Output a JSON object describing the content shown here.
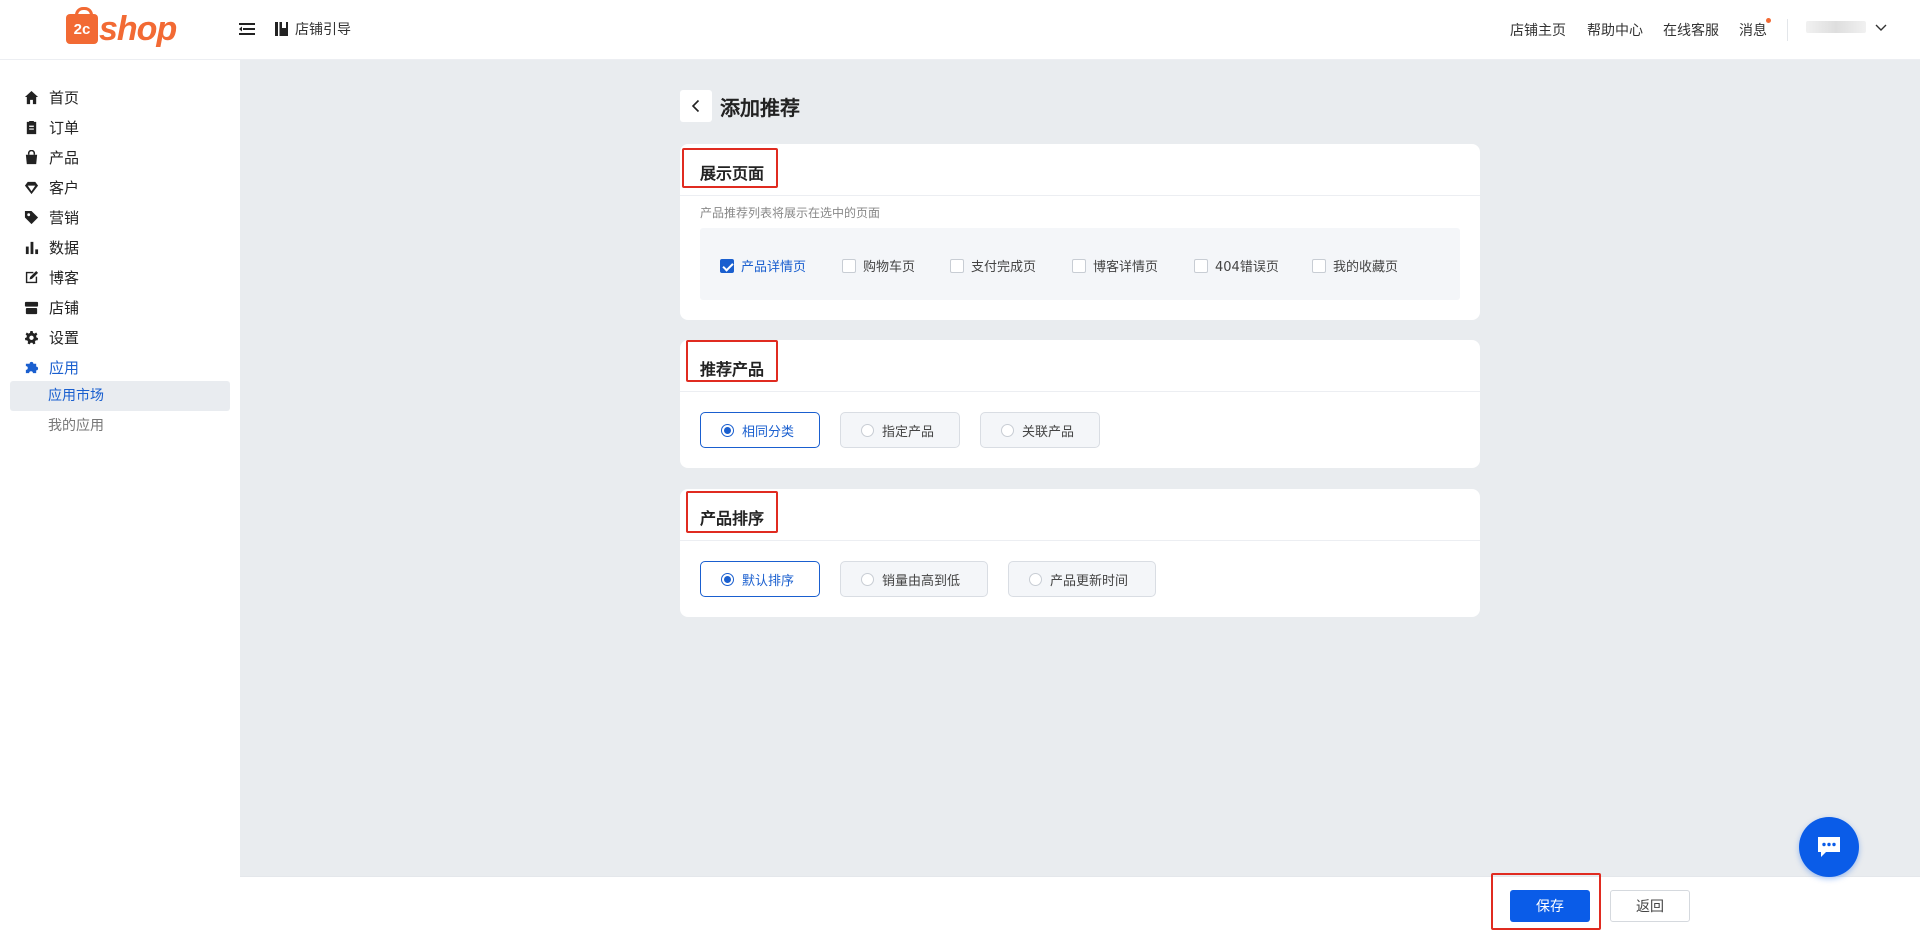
{
  "brand": {
    "logo_mark": "2c",
    "logo_text": "shop"
  },
  "topbar": {
    "guide": "店铺引导",
    "links": [
      "店铺主页",
      "帮助中心",
      "在线客服",
      "消息"
    ]
  },
  "sidebar": {
    "items": [
      {
        "label": "首页",
        "icon": "home-icon"
      },
      {
        "label": "订单",
        "icon": "order-icon"
      },
      {
        "label": "产品",
        "icon": "bag-icon"
      },
      {
        "label": "客户",
        "icon": "diamond-icon"
      },
      {
        "label": "营销",
        "icon": "tag-icon"
      },
      {
        "label": "数据",
        "icon": "bar-chart-icon"
      },
      {
        "label": "博客",
        "icon": "edit-icon"
      },
      {
        "label": "店铺",
        "icon": "store-icon"
      },
      {
        "label": "设置",
        "icon": "gear-icon"
      },
      {
        "label": "应用",
        "icon": "puzzle-icon"
      }
    ],
    "sub_items": [
      "应用市场",
      "我的应用"
    ],
    "active_item": "应用",
    "active_sub": "应用市场"
  },
  "page": {
    "title": "添加推荐"
  },
  "display_section": {
    "title": "展示页面",
    "hint": "产品推荐列表将展示在选中的页面",
    "options": [
      {
        "label": "产品详情页",
        "checked": true
      },
      {
        "label": "购物车页",
        "checked": false
      },
      {
        "label": "支付完成页",
        "checked": false
      },
      {
        "label": "博客详情页",
        "checked": false
      },
      {
        "label": "404错误页",
        "checked": false
      },
      {
        "label": "我的收藏页",
        "checked": false
      }
    ]
  },
  "product_section": {
    "title": "推荐产品",
    "options": [
      "相同分类",
      "指定产品",
      "关联产品"
    ],
    "selected": "相同分类"
  },
  "sort_section": {
    "title": "产品排序",
    "options": [
      "默认排序",
      "销量由高到低",
      "产品更新时间"
    ],
    "selected": "默认排序"
  },
  "footer": {
    "save_label": "保存",
    "back_label": "返回"
  },
  "colors": {
    "brand": "#f26a34",
    "primary": "#0a5ce8",
    "active": "#1a5fcf",
    "highlight": "#e02b20"
  }
}
